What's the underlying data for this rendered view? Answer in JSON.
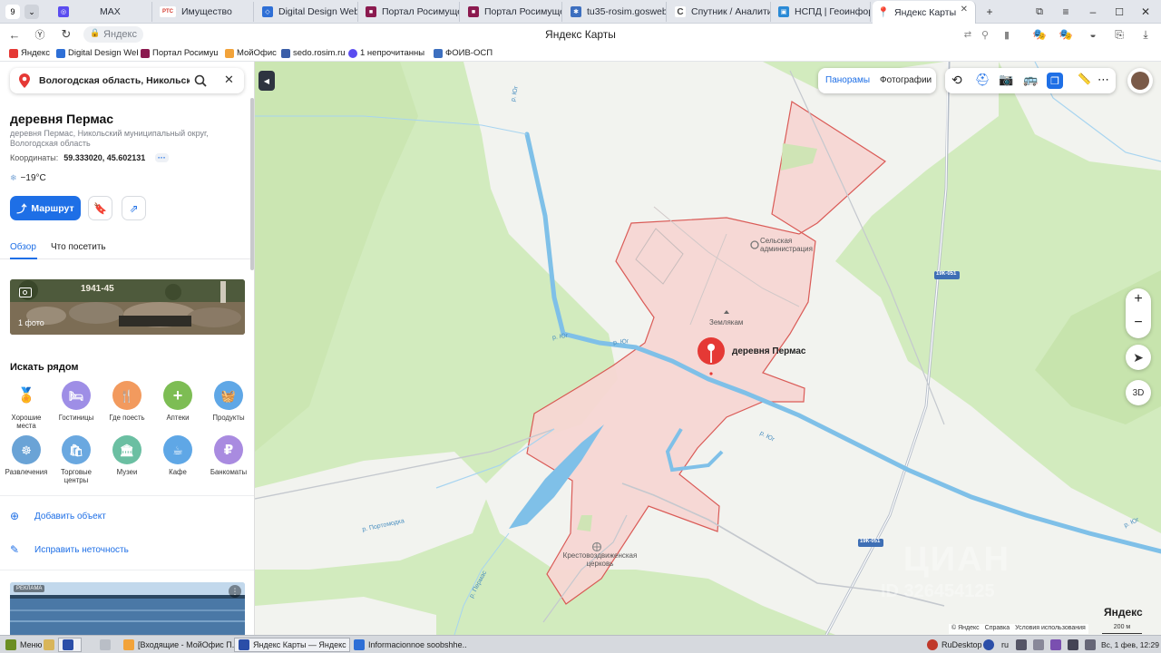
{
  "browser": {
    "tab_counter": "9",
    "tabs": [
      {
        "label": "MAX",
        "color": "#5b4df0"
      },
      {
        "label": "Имущество",
        "color": "#d43a2f",
        "icon_text": "РТС"
      },
      {
        "label": "Digital Design Web C",
        "color": "#2e6fd6"
      },
      {
        "label": "Портал Росимущест",
        "color": "#8b1a4f"
      },
      {
        "label": "Портал Росимущест",
        "color": "#8b1a4f"
      },
      {
        "label": "tu35-rosim.gosweb.",
        "color": "#3d6fbf"
      },
      {
        "label": "Спутник / Аналитик",
        "color": "#444444"
      },
      {
        "label": "НСПД | Геоинформа",
        "color": "#2a8ad6"
      },
      {
        "label": "Яндекс Карты",
        "color": "#e53935",
        "active": true
      }
    ],
    "url_text": "Яндекс",
    "page_title": "Яндекс Карты",
    "bookmarks": [
      {
        "label": "Яндекс",
        "color": "#e53935"
      },
      {
        "label": "Digital Design Web",
        "color": "#2e6fd6"
      },
      {
        "label": "Портал Росимущ",
        "color": "#8b1a4f"
      },
      {
        "label": "МойОфис",
        "color": "#f2a33a"
      },
      {
        "label": "sedo.rosim.ru",
        "color": "#3b5ea8"
      },
      {
        "label": "1 непрочитанный",
        "color": "#5b4df0"
      },
      {
        "label": "ФОИВ-ОСП",
        "color": "#3d6fbf"
      }
    ]
  },
  "sidebar": {
    "search_value": "Вологодская область, Никольский р",
    "place_title": "деревня Пермас",
    "address": "деревня Пермас, Никольский муниципальный округ, Вологодская область",
    "coords_label": "Координаты:",
    "coords_value": "59.333020, 45.602131",
    "weather": "−19°C",
    "route_label": "Маршрут",
    "tabs": [
      "Обзор",
      "Что посетить"
    ],
    "photo_count": "1 фото",
    "photo_caption": "1941-45",
    "nearby_title": "Искать рядом",
    "categories": [
      {
        "label": "Хорошие места",
        "color": "#ffffff",
        "glyph": "📍"
      },
      {
        "label": "Гостиницы",
        "color": "#9e8ee6",
        "glyph": "🛏"
      },
      {
        "label": "Где поесть",
        "color": "#f29a5e",
        "glyph": "🍴"
      },
      {
        "label": "Аптеки",
        "color": "#7dbd54",
        "glyph": "+"
      },
      {
        "label": "Продукты",
        "color": "#5fa7e6",
        "glyph": "🧺"
      },
      {
        "label": "Развлечения",
        "color": "#6aa3d6",
        "glyph": "☸"
      },
      {
        "label": "Торговые центры",
        "color": "#6aa8e0",
        "glyph": "🛍"
      },
      {
        "label": "Музеи",
        "color": "#6bbfa2",
        "glyph": "🏛"
      },
      {
        "label": "Кафе",
        "color": "#5fa7e6",
        "glyph": "☕"
      },
      {
        "label": "Банкоматы",
        "color": "#a98be0",
        "glyph": "₽"
      }
    ],
    "add_object": "Добавить объект",
    "fix_error": "Исправить неточность",
    "ad_badge": "РЕКЛАМА"
  },
  "map": {
    "panoramas": "Панорамы",
    "photos": "Фотографии",
    "zoom_in": "+",
    "zoom_out": "−",
    "btn_3d": "3D",
    "pin_label": "деревня Пермас",
    "poi_admin": "Сельская администрация",
    "poi_zemlyakam": "Землякам",
    "poi_church": "Крестовоздвиженская церковь",
    "river_label": "р. Юг",
    "river_portomodka": "р. Портомодка",
    "river_permas": "р. Пермас",
    "road_label": "19К-051",
    "watermark": "ЦИАН",
    "watermark_id": "ID 326454125",
    "logo": "Яндекс",
    "footer_copy": "© Яндекс",
    "footer_help": "Справка",
    "footer_terms": "Условия использования",
    "scale": "200 м"
  },
  "taskbar": {
    "start": "Меню",
    "items": [
      "[Входящие - МойОфис П...",
      "Яндекс Карты — Яндекс ...",
      "Informacionnoe soobshhe..."
    ],
    "tray_app": "RuDesktop",
    "lang": "ru",
    "clock": "Вс, 1 фев, 12:29"
  },
  "colors": {
    "accent": "#1e6fe6",
    "pin": "#e53935",
    "polygon_fill": "#f7d4d4",
    "polygon_stroke": "#d9534f",
    "water": "#7fc0e8",
    "forest": "#cfe9b8",
    "field": "#f4f4f1"
  }
}
